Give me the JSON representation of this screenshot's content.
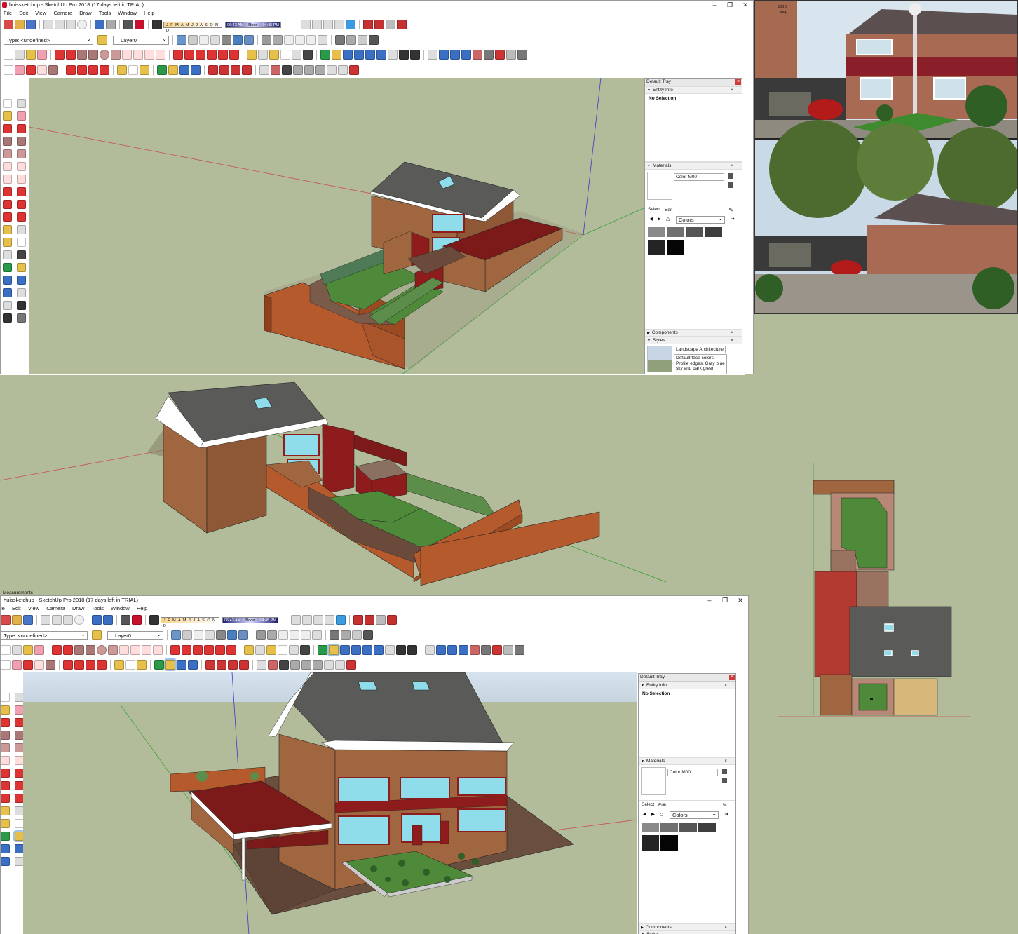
{
  "window": {
    "title": "huissketchup - SketchUp Pro 2018 (17 days left in TRIAL)",
    "menu": [
      "File",
      "Edit",
      "View",
      "Camera",
      "Draw",
      "Tools",
      "Window",
      "Help"
    ],
    "menu_cropped": [
      "le",
      "Edit",
      "View",
      "Camera",
      "Draw",
      "Tools",
      "Window",
      "Help"
    ],
    "controls": {
      "minimize": "–",
      "restore": "❐",
      "close": "✕"
    }
  },
  "toolbar": {
    "type_field": "Type: <undefined>",
    "layer_field": "Layer0",
    "months": "J F M A M J J A S O N D",
    "time_start": "06:43 AM",
    "time_noon": "Noon",
    "time_end": "04:45 PM"
  },
  "measurements_label": "Measurements",
  "tray": {
    "title": "Default Tray",
    "entity_info": "Entity Info",
    "no_selection": "No Selection",
    "materials": "Materials",
    "material_name": "Color M00",
    "select_tab": "Select",
    "edit_tab": "Edit",
    "colors_dropdown": "Colors",
    "components": "Components",
    "styles": "Styles",
    "style_name": "Landscape Architecture S",
    "style_desc": "Default face colors. Profile edges. Gray blue sky and dark green",
    "swatches": [
      "#8a8a8a",
      "#707070",
      "#555555",
      "#3e3e3e",
      "#242424",
      "#050505"
    ]
  },
  "photo": {
    "year": "2010",
    "month": "aug."
  },
  "colors": {
    "ground": "#b2bc9a",
    "roof": "#5a5a58",
    "brick": "#a0663f",
    "fence": "#b55a2c",
    "lawn": "#4f8a3a",
    "accent_red": "#8e1c1c",
    "glass": "#8fdcea"
  }
}
